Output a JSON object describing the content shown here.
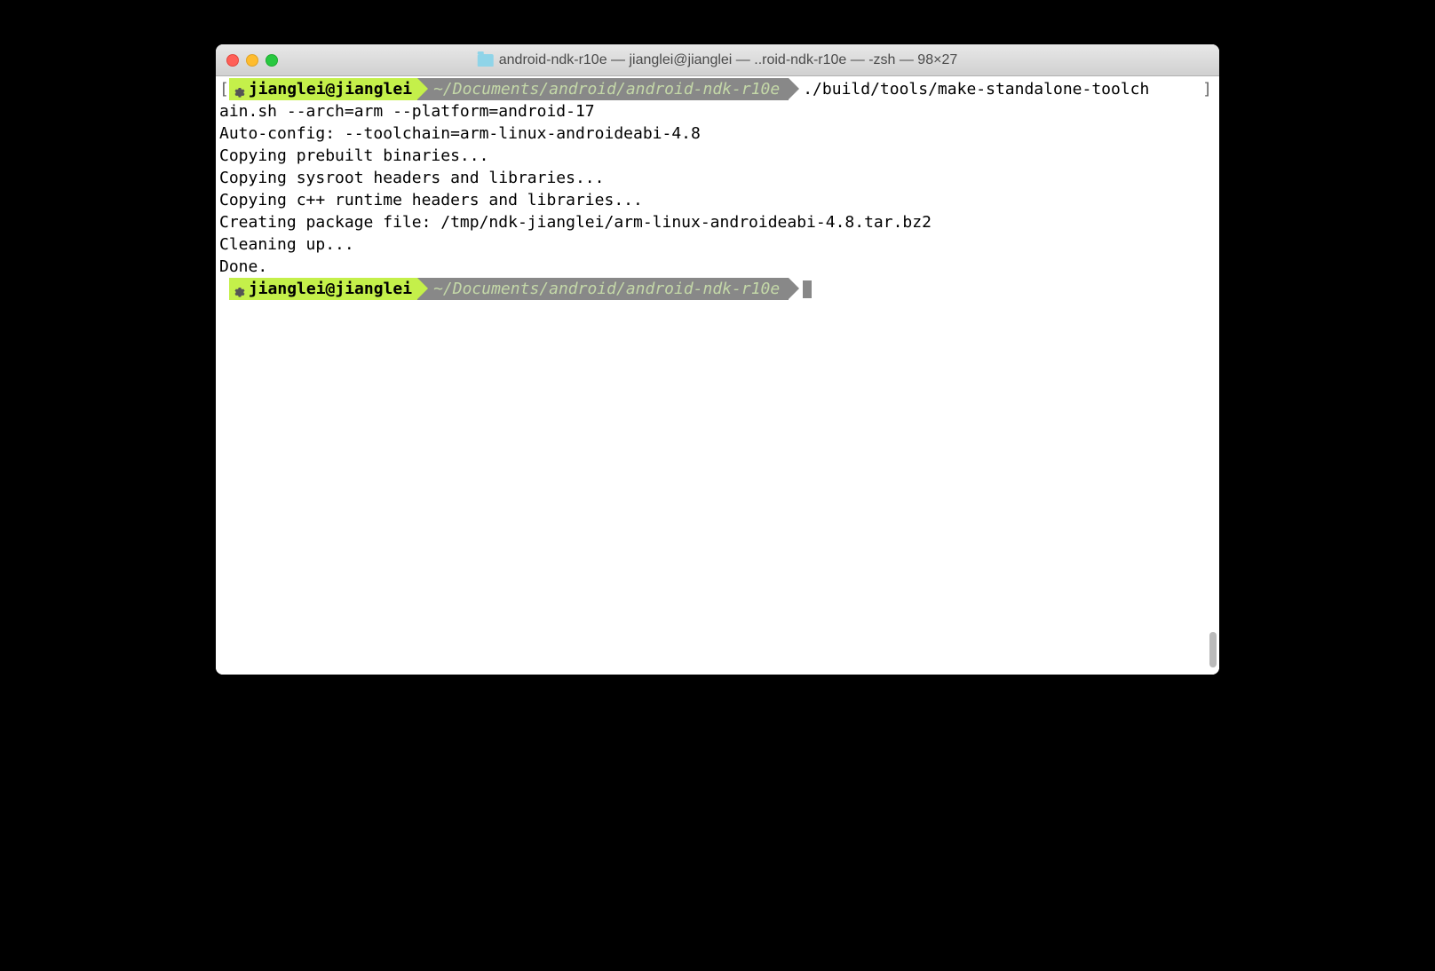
{
  "window": {
    "title": "android-ndk-r10e — jianglei@jianglei — ..roid-ndk-r10e — -zsh — 98×27"
  },
  "prompt1": {
    "user": "jianglei@jianglei",
    "path": "~/Documents/android/android-ndk-r10e",
    "command": "./build/tools/make-standalone-toolch",
    "open_bracket": "[",
    "close_bracket": "]"
  },
  "output": {
    "l1": "ain.sh --arch=arm --platform=android-17",
    "l2": "Auto-config: --toolchain=arm-linux-androideabi-4.8",
    "l3": "Copying prebuilt binaries...",
    "l4": "Copying sysroot headers and libraries...",
    "l5": "Copying c++ runtime headers and libraries...",
    "l6": "Creating package file: /tmp/ndk-jianglei/arm-linux-androideabi-4.8.tar.bz2",
    "l7": "Cleaning up...",
    "l8": "Done."
  },
  "prompt2": {
    "user": "jianglei@jianglei",
    "path": "~/Documents/android/android-ndk-r10e"
  }
}
